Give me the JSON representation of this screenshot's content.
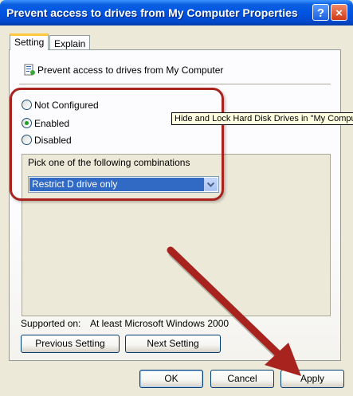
{
  "window": {
    "title": "Prevent access to drives from My Computer Properties"
  },
  "titlebar": {
    "help_label": "?",
    "close_label": "×"
  },
  "tabs": [
    {
      "label": "Setting"
    },
    {
      "label": "Explain"
    }
  ],
  "policy": {
    "title": "Prevent access to drives from My Computer"
  },
  "radios": [
    {
      "label": "Not Configured",
      "checked": false
    },
    {
      "label": "Enabled",
      "checked": true
    },
    {
      "label": "Disabled",
      "checked": false
    }
  ],
  "options": {
    "label": "Pick one of the following combinations",
    "selected": "Restrict D drive only"
  },
  "tooltip": "Hide and Lock Hard Disk Drives in \"My Computer\"",
  "supported": {
    "label": "Supported on:",
    "value": "At least Microsoft Windows 2000"
  },
  "buttons": {
    "previous": "Previous Setting",
    "next": "Next Setting",
    "ok": "OK",
    "cancel": "Cancel",
    "apply": "Apply"
  },
  "colors": {
    "titlebar": "#0054e3",
    "annotation": "#a8231e",
    "selection": "#316ac5"
  }
}
